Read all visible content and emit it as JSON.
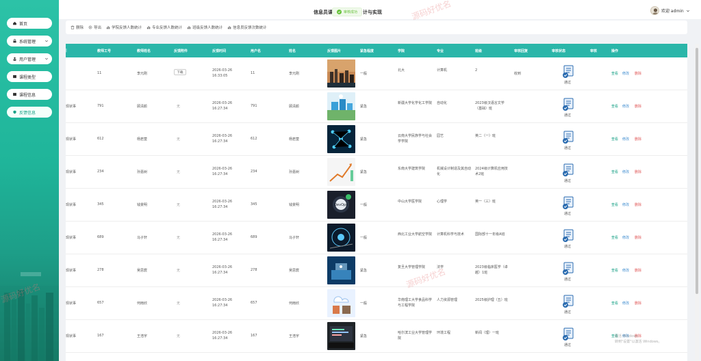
{
  "sidebar": {
    "items": [
      {
        "label": "首页",
        "icon": "home-icon",
        "chevron": false,
        "active": false
      },
      {
        "label": "系统管理",
        "icon": "lock-icon",
        "chevron": true,
        "active": false
      },
      {
        "label": "用户管理",
        "icon": "user-icon",
        "chevron": true,
        "active": false
      },
      {
        "label": "课程类型",
        "icon": "box-icon",
        "chevron": false,
        "active": false
      },
      {
        "label": "课程信息",
        "icon": "box-icon",
        "chevron": false,
        "active": false
      },
      {
        "label": "反馈信息",
        "icon": "shield-icon",
        "chevron": false,
        "active": true
      }
    ]
  },
  "header": {
    "title_prefix": "信息员课",
    "title_suffix": "计与实现",
    "toast": "审核成功",
    "user_label": "欢迎 admin"
  },
  "toolbar": {
    "buttons": [
      {
        "label": "删除",
        "icon": "trash-icon"
      },
      {
        "label": "导出",
        "icon": "export-icon"
      },
      {
        "label": "学院反馈人数统计",
        "icon": "bar-chart-icon"
      },
      {
        "label": "专业反馈人数统计",
        "icon": "bar-chart-icon"
      },
      {
        "label": "班级反馈人数统计",
        "icon": "bar-chart-icon"
      },
      {
        "label": "信息员反馈次数统计",
        "icon": "bar-chart-icon"
      }
    ]
  },
  "table": {
    "headers": [
      "教师工号",
      "教师姓名",
      "反馈附件",
      "反馈时间",
      "用户名",
      "姓名",
      "反馈图片",
      "紧急程度",
      "学院",
      "专业",
      "班级",
      "审核回复",
      "审核状态",
      "审核",
      "操作"
    ],
    "action_labels": {
      "view": "查看",
      "edit": "修改",
      "delete": "删除"
    },
    "download_label": "下载",
    "rows": [
      {
        "lead": "",
        "teacher_id": "11",
        "teacher_name": "李元刚",
        "attachment": "download",
        "time": "2026-03-26 16:33:05",
        "username": "11",
        "name": "李元刚",
        "urgency": "一般",
        "college": "北大",
        "major": "计算机",
        "class": "2",
        "reply": "收到",
        "status": "通过"
      },
      {
        "lead": "现状事",
        "teacher_id": "791",
        "teacher_name": "顾清颜",
        "attachment": "无",
        "time": "2026-03-26 16:27:34",
        "username": "791",
        "name": "顾清颜",
        "urgency": "紧急",
        "college": "新疆大学化学化工学院",
        "major": "自动化",
        "class": "2023级汉语言文学（基础）班",
        "reply": "",
        "status": "通过"
      },
      {
        "lead": "现状事",
        "teacher_id": "612",
        "teacher_name": "杨若萱",
        "attachment": "无",
        "time": "2026-03-26 16:27:34",
        "username": "612",
        "name": "杨若萱",
        "urgency": "紧急",
        "college": "云南大学民族学与社会学学院",
        "major": "园艺",
        "class": "英二（一）班",
        "reply": "",
        "status": "通过"
      },
      {
        "lead": "现状事",
        "teacher_id": "234",
        "teacher_name": "孙嘉树",
        "attachment": "无",
        "time": "2026-03-26 16:27:34",
        "username": "234",
        "name": "孙嘉树",
        "urgency": "紧急",
        "college": "东南大学建筑学院",
        "major": "机械设计制造及其自动化",
        "class": "2024级计算机应用技术2班",
        "reply": "",
        "status": "通过"
      },
      {
        "lead": "现状事",
        "teacher_id": "345",
        "teacher_name": "钱景明",
        "attachment": "无",
        "time": "2026-03-26 16:27:34",
        "username": "345",
        "name": "钱景明",
        "urgency": "一般",
        "college": "中山大学医学院",
        "major": "心理学",
        "class": "英一（三）班",
        "reply": "",
        "status": "通过"
      },
      {
        "lead": "现状事",
        "teacher_id": "689",
        "teacher_name": "马子轩",
        "attachment": "无",
        "time": "2026-03-26 16:27:34",
        "username": "689",
        "name": "马子轩",
        "urgency": "一般",
        "college": "西北工业大学航空学院",
        "major": "计算机科学与技术",
        "class": "国际部十一年级A班",
        "reply": "",
        "status": "通过"
      },
      {
        "lead": "现状事",
        "teacher_id": "278",
        "teacher_name": "吴思宸",
        "attachment": "无",
        "time": "2026-03-26 16:27:34",
        "username": "278",
        "name": "吴思宸",
        "urgency": "紧急",
        "college": "复旦大学管理学院",
        "major": "法学",
        "class": "2023级临床医学（卓越）1班",
        "reply": "",
        "status": "通过"
      },
      {
        "lead": "现状事",
        "teacher_id": "657",
        "teacher_name": "何雨欣",
        "attachment": "无",
        "time": "2026-03-26 16:27:34",
        "username": "657",
        "name": "何雨欣",
        "urgency": "一般",
        "college": "华南理工大学食品科学与工程学院",
        "major": "人力资源管理",
        "class": "2025级护理（五）班",
        "reply": "",
        "status": "通过"
      },
      {
        "lead": "现状事",
        "teacher_id": "167",
        "teacher_name": "王浩宇",
        "attachment": "无",
        "time": "2026-03-26 16:27:34",
        "username": "167",
        "name": "王浩宇",
        "urgency": "紧急",
        "college": "哈尔滨工业大学管理学院",
        "major": "环境工程",
        "class": "新闻（理）一班",
        "reply": "",
        "status": "通过"
      }
    ]
  },
  "watermarks": [
    "源码好优名",
    "源码好优名",
    "源码好优名"
  ],
  "windows_activation": {
    "line1": "激活 Windows",
    "line2": "转到\"设置\"以激活 Windows。"
  },
  "colors": {
    "accent": "#2ab6a9",
    "sidebar": "#1fb59a",
    "view": "#16a085",
    "edit": "#3d8ccf",
    "delete": "#e15b5b"
  }
}
